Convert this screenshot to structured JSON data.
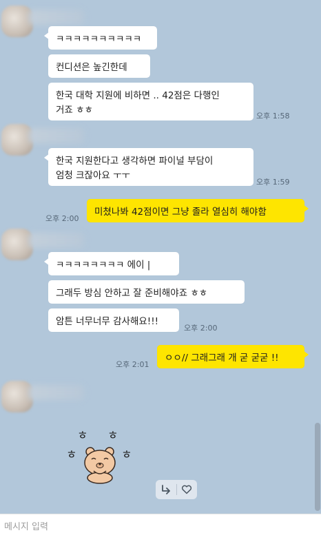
{
  "messages": [
    {
      "text": "ㅋㅋㅋㅋㅋㅋㅋㅋㅋㅋ",
      "from": "other"
    },
    {
      "text": "컨디션은 높긴한데",
      "from": "other"
    },
    {
      "text": "한국 대학 지원에 비하면 .. 42점은 다행인\n거죠 ㅎㅎ",
      "from": "other",
      "time": "오후 1:58"
    },
    {
      "text": "한국 지원한다고 생각하면 파이널 부담이\n엄청 크잖아요 ㅜㅜ",
      "from": "other",
      "time": "오후 1:59"
    },
    {
      "text": "미쳤나봐 42점이면 그냥 졸라 열심히 해야함",
      "from": "me",
      "time": "오후 2:00"
    },
    {
      "text": "ㅋㅋㅋㅋㅋㅋㅋㅋ 에이 |",
      "from": "other"
    },
    {
      "text": "그래두 방심 안하고 잘 준비해야죠 ㅎㅎ",
      "from": "other"
    },
    {
      "text": "암튼 너무너무 감사해요!!!",
      "from": "other",
      "time": "오후 2:00"
    },
    {
      "text": "ㅇㅇ// 그래그래 개 굳 굳굳 !!",
      "from": "me",
      "time": "오후 2:01"
    }
  ],
  "sticker": {
    "icon": "laughing-bear-sticker",
    "glyphs": [
      "ㅎ",
      "ㅎ",
      "ㅎ",
      "ㅎ"
    ]
  },
  "actions": {
    "share_icon": "share-arrow-icon",
    "like_icon": "heart-icon"
  },
  "input": {
    "placeholder": "메시지 입력",
    "value": ""
  },
  "colors": {
    "background": "#b2c7da",
    "my_bubble": "#fee500",
    "other_bubble": "#ffffff"
  }
}
